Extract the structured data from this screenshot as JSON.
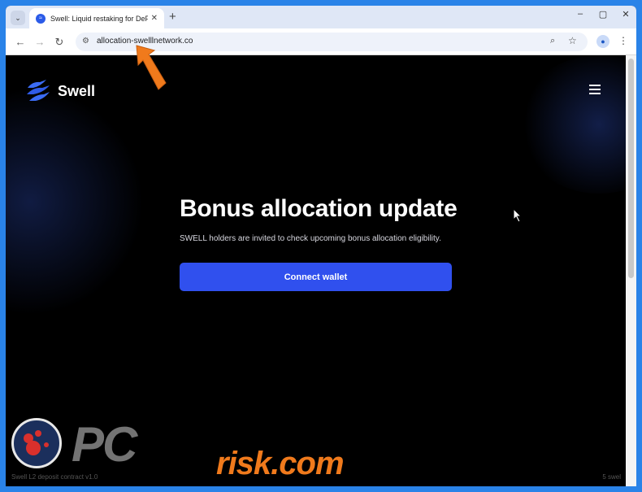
{
  "browser": {
    "tab_title": "Swell: Liquid restaking for DeFi",
    "tab_close": "✕",
    "new_tab": "+",
    "url": "allocation-swelllnetwork.co",
    "window_controls": [
      "–",
      "▢",
      "✕"
    ]
  },
  "site": {
    "brand": "Swell",
    "hero_title": "Bonus allocation update",
    "hero_subtitle": "SWELL holders are invited to check upcoming bonus allocation eligibility.",
    "connect_button": "Connect wallet",
    "footer_left": "Swell L2 deposit contract v1.0",
    "footer_right": "5 swel"
  },
  "watermark": {
    "pc": "PC",
    "risk": "risk.com"
  },
  "colors": {
    "accent": "#3050ee",
    "annotation_arrow": "#f07a1c"
  }
}
